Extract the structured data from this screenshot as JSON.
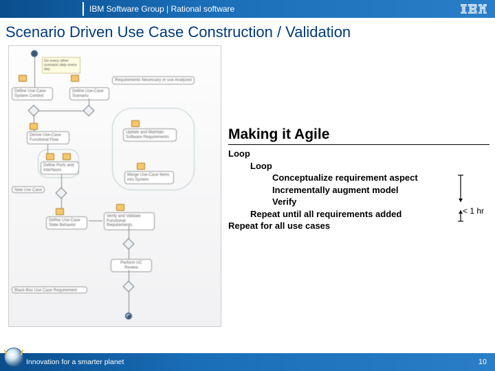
{
  "header": {
    "group_text": "IBM Software Group | Rational software",
    "logo_label": "IBM"
  },
  "title": "Scenario Driven Use Case Construction / Validation",
  "agile": {
    "heading": "Making it Agile",
    "lines": [
      {
        "text": "Loop",
        "indent": 0
      },
      {
        "text": "Loop",
        "indent": 1
      },
      {
        "text": "Conceptualize requirement aspect",
        "indent": 2
      },
      {
        "text": "Incrementally augment model",
        "indent": 2
      },
      {
        "text": "Verify",
        "indent": 2
      },
      {
        "text": "Repeat until all requirements added",
        "indent": 1
      },
      {
        "text": "Repeat for all use cases",
        "indent": 0
      }
    ],
    "duration_label": "< 1 hr"
  },
  "diagram": {
    "note_text": "Do every other scenario step every day",
    "leftcol_label": "Define Use-Case System Context",
    "centercol_label": "Define Use-Case Scenario",
    "derive_label": "Derive Use-Case Functional Flow",
    "ports_label": "Define Ports and Interfaces",
    "update_label": "Update and Maintain Software Requirements",
    "state_label": "Define Use-Case State Behavior",
    "verify_label": "Verify and Validate Functional Requirements",
    "perform_label": "Perform UC Review",
    "merge_label": "Merge Use-Case Items into System",
    "black_label": "Black-Box Use Case Requirement",
    "req_title": "Requirements Necessary or use Analyzed"
  },
  "footer": {
    "tagline": "Innovation for a smarter planet",
    "page": "10"
  }
}
